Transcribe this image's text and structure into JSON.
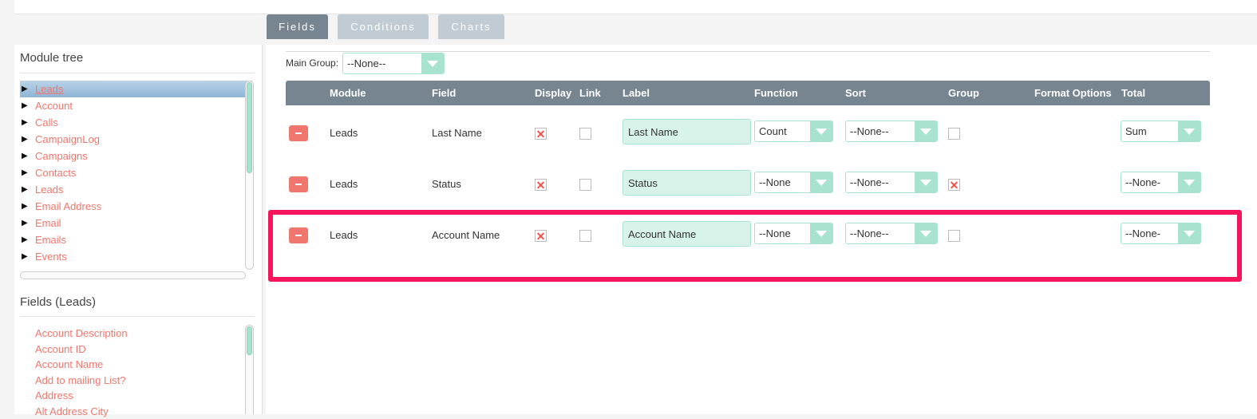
{
  "tabs": [
    {
      "label": "Fields"
    },
    {
      "label": "Conditions"
    },
    {
      "label": "Charts"
    }
  ],
  "module_tree": {
    "title": "Module tree",
    "items": [
      {
        "label": "Leads"
      },
      {
        "label": "Account"
      },
      {
        "label": "Calls"
      },
      {
        "label": "CampaignLog"
      },
      {
        "label": "Campaigns"
      },
      {
        "label": "Contacts"
      },
      {
        "label": "Leads"
      },
      {
        "label": "Email Address"
      },
      {
        "label": "Email"
      },
      {
        "label": "Emails"
      },
      {
        "label": "Events"
      }
    ]
  },
  "fields_panel": {
    "title": "Fields (Leads)",
    "items": [
      {
        "label": "Account Description"
      },
      {
        "label": "Account ID"
      },
      {
        "label": "Account Name"
      },
      {
        "label": "Add to mailing List?"
      },
      {
        "label": "Address"
      },
      {
        "label": "Alt Address City"
      }
    ]
  },
  "main_group": {
    "label": "Main Group:",
    "value": "--None--"
  },
  "table": {
    "headers": {
      "module": "Module",
      "field": "Field",
      "display": "Display",
      "link": "Link",
      "label": "Label",
      "function": "Function",
      "sort": "Sort",
      "group": "Group",
      "format": "Format Options",
      "total": "Total"
    },
    "rows": [
      {
        "module": "Leads",
        "field": "Last Name",
        "display": true,
        "link": false,
        "label": "Last Name",
        "function": "Count",
        "sort": "--None--",
        "group": false,
        "total": "Sum"
      },
      {
        "module": "Leads",
        "field": "Status",
        "display": true,
        "link": false,
        "label": "Status",
        "function": "--None",
        "sort": "--None--",
        "group": true,
        "total": "--None-"
      },
      {
        "module": "Leads",
        "field": "Account Name",
        "display": true,
        "link": false,
        "label": "Account Name",
        "function": "--None",
        "sort": "--None--",
        "group": false,
        "total": "--None-"
      }
    ]
  },
  "colors": {
    "accent": "#a7e3cf",
    "header": "#778591",
    "link": "#f0776d",
    "highlight": "#f5155d"
  }
}
